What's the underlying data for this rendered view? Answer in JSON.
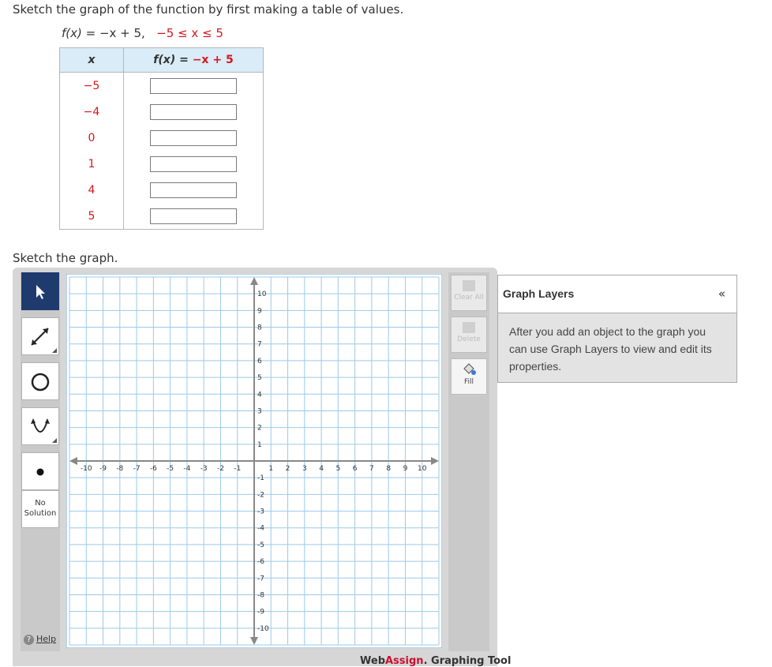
{
  "question": {
    "instruction": "Sketch the graph of the function by first making a table of values.",
    "func_lhs": "f(x) = ",
    "func_rhs": "−x + 5,",
    "domain": "−5 ≤ x ≤ 5"
  },
  "table": {
    "col_x": "x",
    "col_f_lhs": "f(x) = ",
    "col_f_rhs": "−x + 5",
    "rows": [
      {
        "x": "−5",
        "value": ""
      },
      {
        "x": "−4",
        "value": ""
      },
      {
        "x": "0",
        "value": ""
      },
      {
        "x": "1",
        "value": ""
      },
      {
        "x": "4",
        "value": ""
      },
      {
        "x": "5",
        "value": ""
      }
    ]
  },
  "graph_prompt": "Sketch the graph.",
  "toolbar": {
    "no_solution_line1": "No",
    "no_solution_line2": "Solution",
    "help": "Help"
  },
  "side_tools": {
    "clear_all": "Clear All",
    "delete": "Delete",
    "fill": "Fill"
  },
  "graph": {
    "x_ticks": [
      "-10",
      "-9",
      "-8",
      "-7",
      "-6",
      "-5",
      "-4",
      "-3",
      "-2",
      "-1",
      "1",
      "2",
      "3",
      "4",
      "5",
      "6",
      "7",
      "8",
      "9",
      "10"
    ],
    "y_ticks": [
      "10",
      "9",
      "8",
      "7",
      "6",
      "5",
      "4",
      "3",
      "2",
      "1",
      "-1",
      "-2",
      "-3",
      "-4",
      "-5",
      "-6",
      "-7",
      "-8",
      "-9",
      "-10"
    ],
    "xlim": [
      -11,
      11
    ],
    "ylim": [
      -11,
      11
    ]
  },
  "branding": {
    "part1": "Web",
    "part2": "Assign",
    "part3": ". Graphing Tool"
  },
  "layers": {
    "title": "Graph Layers",
    "collapse": "«",
    "body": "After you add an object to the graph you can use Graph Layers to view and edit its properties."
  },
  "colors": {
    "accent_red": "#d8161b",
    "header_blue": "#d9ecf7",
    "selected_tool": "#1f3b6e",
    "grid_line": "#9cc9ea"
  }
}
